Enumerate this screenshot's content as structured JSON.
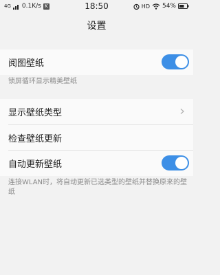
{
  "status_bar": {
    "network": "4G",
    "speed": "0.1K/s",
    "time": "18:50",
    "hd": "HD",
    "battery": "54%"
  },
  "header": {
    "title": "设置"
  },
  "settings": {
    "wallpaper_browse": {
      "label": "阅图壁纸",
      "enabled": true,
      "note": "锁屏循环显示精美壁纸"
    },
    "show_types": {
      "label": "显示壁纸类型"
    },
    "check_updates": {
      "label": "检查壁纸更新"
    },
    "auto_update": {
      "label": "自动更新壁纸",
      "enabled": true,
      "note": "连接WLAN时，将自动更新已选类型的壁纸并替换原来的壁纸"
    }
  },
  "colors": {
    "accent": "#3d8fe6",
    "background": "#f2f2f2",
    "card": "#fafafa"
  },
  "icons": [
    "signal-icon",
    "k-badge-icon",
    "alarm-icon",
    "wifi-icon",
    "battery-icon",
    "chevron-right-icon"
  ]
}
